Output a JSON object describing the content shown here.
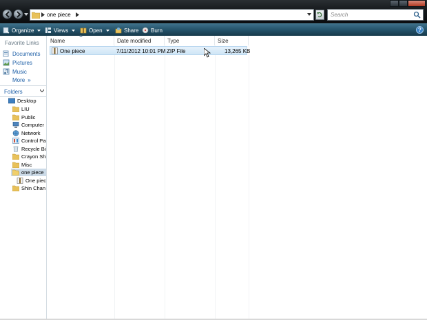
{
  "address": {
    "path_label": "one piece"
  },
  "search": {
    "placeholder": "Search"
  },
  "toolbar": {
    "organize": "Organize",
    "views": "Views",
    "open": "Open",
    "share": "Share",
    "burn": "Burn"
  },
  "favorites": {
    "title": "Favorite Links",
    "items": [
      {
        "label": "Documents",
        "icon": "documents-icon"
      },
      {
        "label": "Pictures",
        "icon": "pictures-icon"
      },
      {
        "label": "Music",
        "icon": "music-icon"
      }
    ],
    "more": "More"
  },
  "folders": {
    "title": "Folders",
    "items": [
      {
        "label": "Desktop",
        "icon": "desktop-icon"
      },
      {
        "label": "LIU",
        "icon": "folder-icon"
      },
      {
        "label": "Public",
        "icon": "folder-icon"
      },
      {
        "label": "Computer",
        "icon": "computer-icon"
      },
      {
        "label": "Network",
        "icon": "network-icon"
      },
      {
        "label": "Control Par",
        "icon": "control-panel-icon"
      },
      {
        "label": "Recycle Bin",
        "icon": "recycle-bin-icon"
      },
      {
        "label": "Crayon Shin",
        "icon": "folder-icon"
      },
      {
        "label": "Misc",
        "icon": "folder-icon"
      },
      {
        "label": "one piece",
        "icon": "folder-icon",
        "selected": true
      },
      {
        "label": "One piece",
        "icon": "zip-icon"
      },
      {
        "label": "Shin Chan",
        "icon": "folder-icon"
      }
    ]
  },
  "columns": {
    "name": "Name",
    "date": "Date modified",
    "type": "Type",
    "size": "Size"
  },
  "files": [
    {
      "name": "One piece",
      "date": "7/11/2012 10:01 PM",
      "type": "ZIP File",
      "size": "13,265 KB"
    }
  ],
  "colors": {
    "toolbar": "#245269",
    "selection": "#cfe5f6",
    "link": "#1c5ea6"
  }
}
